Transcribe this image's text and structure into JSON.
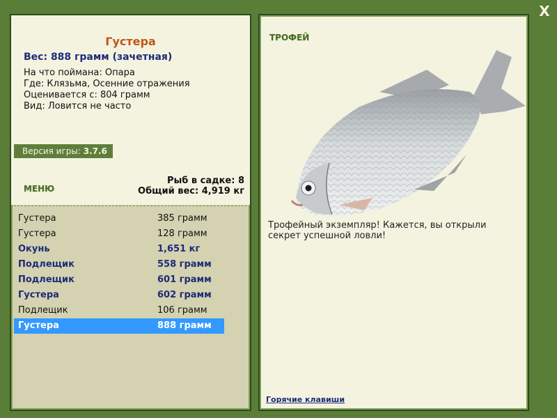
{
  "fish": {
    "title": "Густера",
    "weight_line": "Вес: 888 грамм (зачетная)",
    "bait": "На что поймана: Опара",
    "location": "Где: Клязьма, Осенние отражения",
    "rated_from": "Оценивается с: 804 грамм",
    "rarity": "Вид: Ловится не часто"
  },
  "version": {
    "label": "Версия игры:",
    "value": "3.7.6"
  },
  "menu_label": "МЕНЮ",
  "keepnet": {
    "count": "Рыб в садке: 8",
    "total": "Общий вес: 4,919 кг"
  },
  "catches": [
    {
      "name": "Густера",
      "weight": "385 грамм",
      "style": "normal"
    },
    {
      "name": "Густера",
      "weight": "128 грамм",
      "style": "normal"
    },
    {
      "name": "Окунь",
      "weight": "1,651 кг",
      "style": "bold"
    },
    {
      "name": "Подлещик",
      "weight": "558 грамм",
      "style": "bold"
    },
    {
      "name": "Подлещик",
      "weight": "601 грамм",
      "style": "bold"
    },
    {
      "name": "Густера",
      "weight": "602 грамм",
      "style": "bold"
    },
    {
      "name": "Подлещик",
      "weight": "106 грамм",
      "style": "normal"
    },
    {
      "name": "Густера",
      "weight": "888 грамм",
      "style": "selected"
    }
  ],
  "trophy": {
    "label": "ТРОФЕЙ",
    "text": "Трофейный экземпляр! Кажется, вы открыли секрет успешной ловли!"
  },
  "hotkeys_label": "Горячие клавиши",
  "close_label": "X",
  "icons": {
    "close": "close-icon",
    "fish": "fish-image"
  }
}
